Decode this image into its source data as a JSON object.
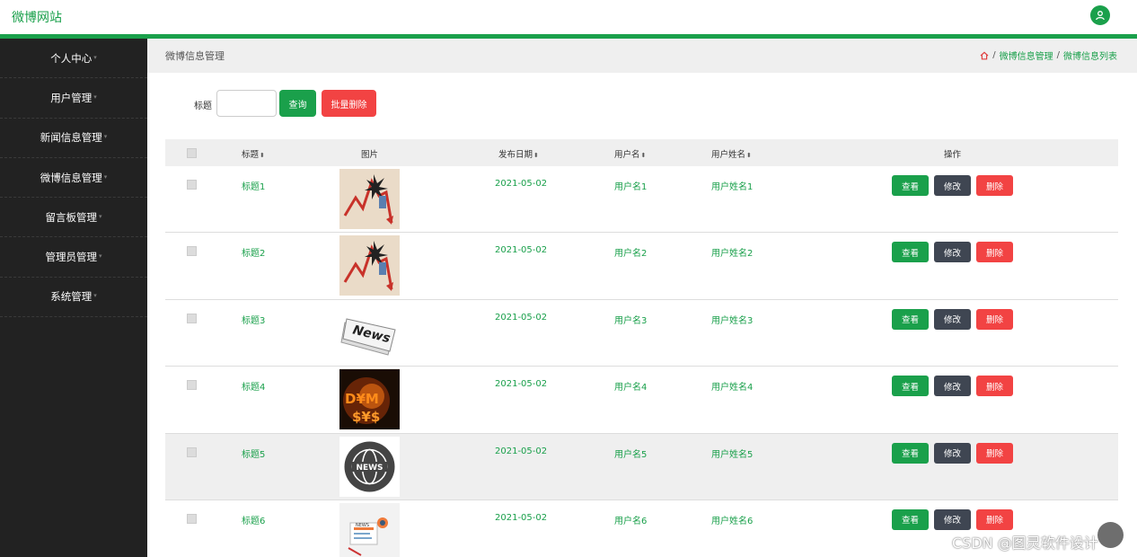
{
  "header": {
    "brand": "微博网站",
    "user_icon": "user-icon"
  },
  "accent_color": "#1aa04b",
  "sidebar": {
    "items": [
      {
        "label": "个人中心"
      },
      {
        "label": "用户管理"
      },
      {
        "label": "新闻信息管理"
      },
      {
        "label": "微博信息管理"
      },
      {
        "label": "留言板管理"
      },
      {
        "label": "管理员管理"
      },
      {
        "label": "系统管理"
      }
    ]
  },
  "breadcrumb": {
    "page_title": "微博信息管理",
    "home_icon": "home-icon",
    "items": [
      "微博信息管理",
      "微博信息列表"
    ],
    "separator": "/"
  },
  "search": {
    "label": "标题",
    "value": "",
    "query_button": "查询",
    "batch_delete_button": "批量删除"
  },
  "table": {
    "columns": [
      "标题",
      "图片",
      "发布日期",
      "用户名",
      "用户姓名",
      "操作"
    ],
    "rows": [
      {
        "title": "标题1",
        "image": "chart-down-image",
        "date": "2021-05-02",
        "username": "用户名1",
        "name": "用户姓名1"
      },
      {
        "title": "标题2",
        "image": "chart-down-image",
        "date": "2021-05-02",
        "username": "用户名2",
        "name": "用户姓名2"
      },
      {
        "title": "标题3",
        "image": "newspaper-image",
        "date": "2021-05-02",
        "username": "用户名3",
        "name": "用户姓名3"
      },
      {
        "title": "标题4",
        "image": "currency-fire-image",
        "date": "2021-05-02",
        "username": "用户名4",
        "name": "用户姓名4"
      },
      {
        "title": "标题5",
        "image": "news-globe-image",
        "date": "2021-05-02",
        "username": "用户名5",
        "name": "用户姓名5"
      },
      {
        "title": "标题6",
        "image": "news-illustration-image",
        "date": "2021-05-02",
        "username": "用户名6",
        "name": "用户姓名6"
      }
    ],
    "actions": {
      "view": "查看",
      "edit": "修改",
      "delete": "删除"
    }
  },
  "watermark": "CSDN @图灵软件设计"
}
